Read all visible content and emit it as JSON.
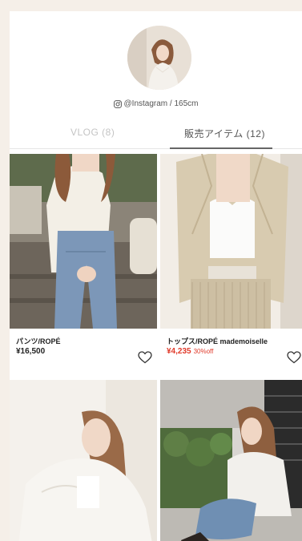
{
  "profile": {
    "handle_text": "@Instagram / 165cm",
    "icon": "instagram-icon"
  },
  "tabs": [
    {
      "label": "VLOG (8)",
      "active": false
    },
    {
      "label": "販売アイテム (12)",
      "active": true
    }
  ],
  "items": [
    {
      "title": "パンツ/ROPÉ",
      "price": "¥16,500",
      "sale": false,
      "discount": ""
    },
    {
      "title": "トップス/ROPÉ mademoiselle",
      "price": "¥4,235",
      "sale": true,
      "discount": "30%off"
    }
  ],
  "colors": {
    "background": "#f5efe8",
    "sale_price": "#e03a2a",
    "tab_inactive": "#c4c4c4"
  }
}
